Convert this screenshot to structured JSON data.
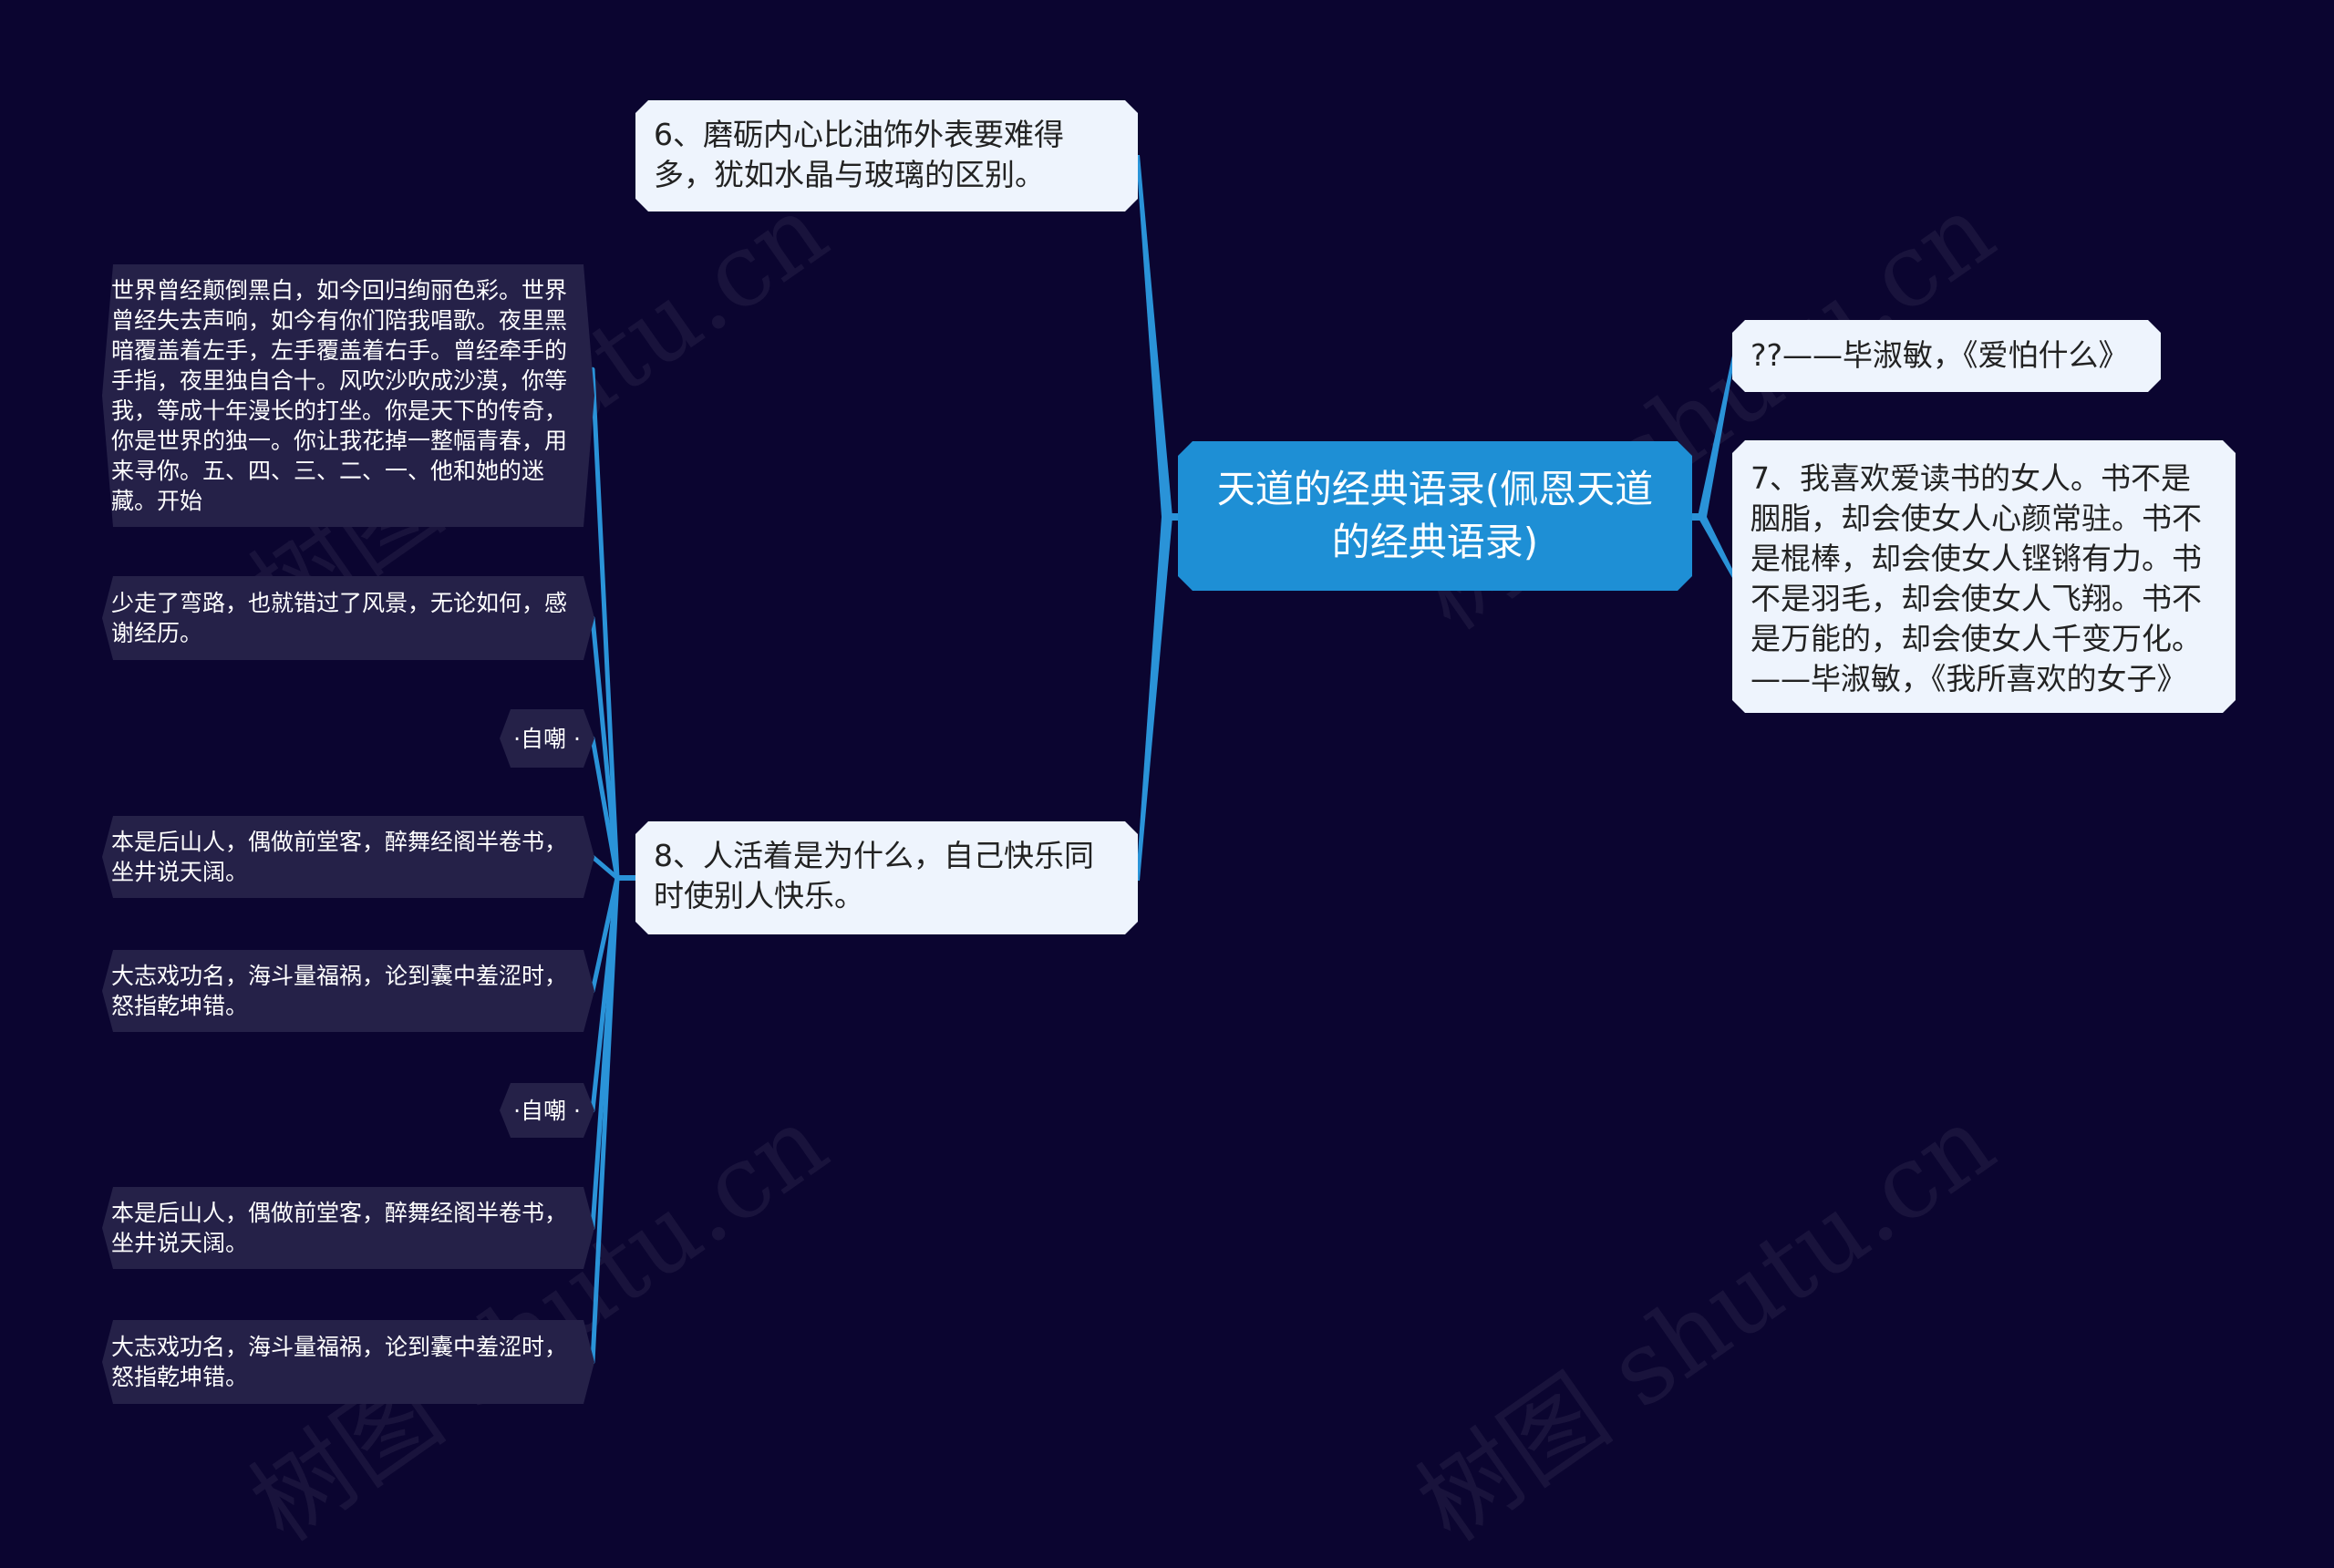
{
  "colors": {
    "background": "#0b0530",
    "root_fill": "#1e8fd5",
    "branch_fill": "#eef4fd",
    "leaf_fill": "#252148",
    "connector": "#2a93d8"
  },
  "watermark": "树图 shutu.cn",
  "root": {
    "label": "天道的经典语录(佩恩天道的经典语录)"
  },
  "branches": [
    {
      "id": "b6",
      "side": "left",
      "label": "6、磨砺内心比油饰外表要难得多，犹如水晶与玻璃的区别。"
    },
    {
      "id": "b8",
      "side": "left",
      "label": "8、人活着是为什么，自己快乐同时使别人快乐。",
      "children": [
        "世界曾经颠倒黑白，如今回归绚丽色彩。世界曾经失去声响，如今有你们陪我唱歌。夜里黑暗覆盖着左手，左手覆盖着右手。曾经牵手的手指，夜里独自合十。风吹沙吹成沙漠，你等我，等成十年漫长的打坐。你是天下的传奇，你是世界的独一。你让我花掉一整幅青春，用来寻你。五、四、三、二、一、他和她的迷藏。开始",
        "少走了弯路，也就错过了风景，无论如何，感谢经历。",
        "·自嘲 ·",
        "本是后山人，偶做前堂客，醉舞经阁半卷书，坐井说天阔。",
        "大志戏功名，海斗量福祸，论到囊中羞涩时，怒指乾坤错。",
        "·自嘲 ·",
        "本是后山人，偶做前堂客，醉舞经阁半卷书，坐井说天阔。",
        "大志戏功名，海斗量福祸，论到囊中羞涩时，怒指乾坤错。"
      ]
    },
    {
      "id": "bq",
      "side": "right",
      "label": "??——毕淑敏，《爱怕什么》"
    },
    {
      "id": "b7",
      "side": "right",
      "label": "7、我喜欢爱读书的女人。书不是胭脂，却会使女人心颜常驻。书不是棍棒，却会使女人铿锵有力。书不是羽毛，却会使女人飞翔。书不是万能的，却会使女人千变万化。——毕淑敏，《我所喜欢的女子》"
    }
  ]
}
